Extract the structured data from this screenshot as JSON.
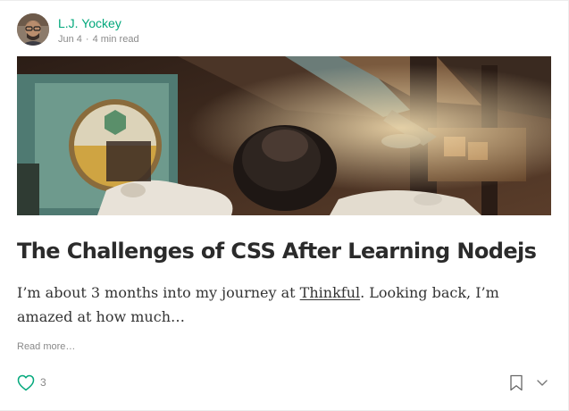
{
  "author": {
    "name": "L.J. Yockey",
    "avatar_icon": "avatar-photo"
  },
  "meta": {
    "date": "Jun 4",
    "separator": "·",
    "read_time": "4 min read"
  },
  "hero_image": {
    "icon": "hero-image-workshop-scene"
  },
  "post": {
    "title": "The Challenges of CSS After Learning Nodejs",
    "excerpt_before": "I’m about 3 months into my journey at ",
    "excerpt_link": "Thinkful",
    "excerpt_after": ". Looking back, I’m amazed at how much…",
    "read_more": "Read more…"
  },
  "actions": {
    "clap_icon": "heart-icon",
    "clap_count": "3",
    "bookmark_icon": "bookmark-icon",
    "more_icon": "chevron-down-icon"
  },
  "colors": {
    "accent": "#03a87c",
    "title": "#2b2b2b",
    "muted": "#8a8a8a"
  }
}
